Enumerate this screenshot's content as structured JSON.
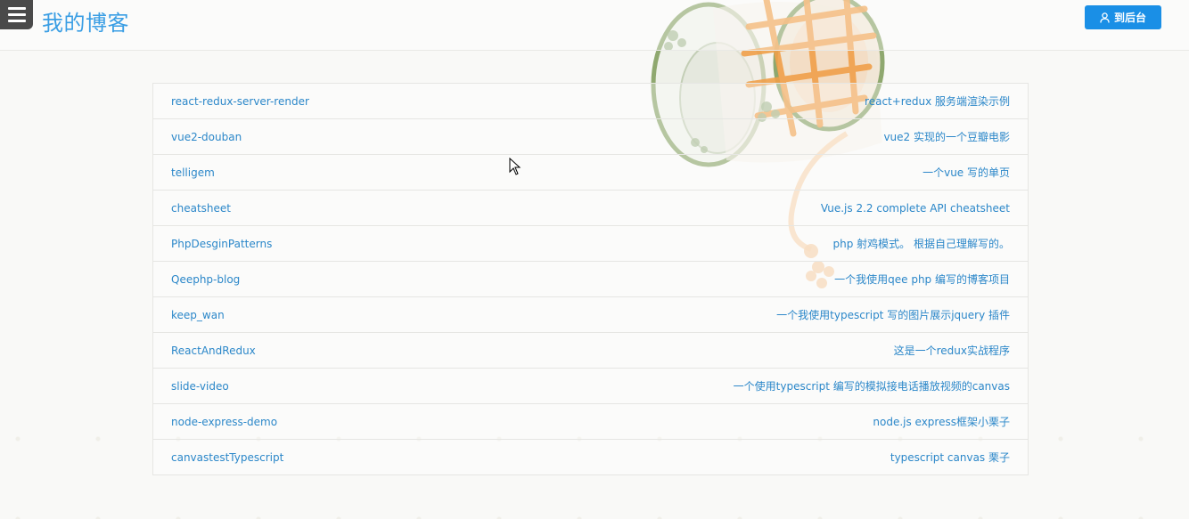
{
  "header": {
    "site_title": "我的博客",
    "admin_button_label": "到后台",
    "menu_icon": "hamburger-icon",
    "admin_icon": "user-icon"
  },
  "colors": {
    "accent": "#1a8fe6",
    "link": "#2b87c9",
    "title": "#3a9ee4"
  },
  "projects": [
    {
      "name": "react-redux-server-render",
      "description": "react+redux 服务端渲染示例"
    },
    {
      "name": "vue2-douban",
      "description": "vue2 实现的一个豆瓣电影"
    },
    {
      "name": "telligem",
      "description": "一个vue 写的单页"
    },
    {
      "name": "cheatsheet",
      "description": "Vue.js 2.2 complete API cheatsheet"
    },
    {
      "name": "PhpDesginPatterns",
      "description": "php 射鸡模式。 根据自己理解写的。"
    },
    {
      "name": "Qeephp-blog",
      "description": "一个我使用qee php 编写的博客项目"
    },
    {
      "name": "keep_wan",
      "description": "一个我使用typescript 写的图片展示jquery 插件"
    },
    {
      "name": "ReactAndRedux",
      "description": "这是一个redux实战程序"
    },
    {
      "name": "slide-video",
      "description": "一个使用typescript 编写的模拟接电话播放视频的canvas"
    },
    {
      "name": "node-express-demo",
      "description": "node.js express框架小栗子"
    },
    {
      "name": "canvastestTypescript",
      "description": "typescript canvas 栗子"
    }
  ]
}
